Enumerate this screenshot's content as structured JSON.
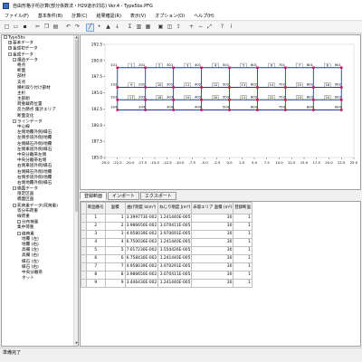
{
  "window": {
    "title": "自由形格子桁計算(部分係数法・H29道示対応) Ver.4 - Type5bs.PFG"
  },
  "menu": [
    "ファイル(F)",
    "基本条件(B)",
    "計算(C)",
    "結果確認(R)",
    "表示(V)",
    "オプション(O)",
    "ヘルプ(H)"
  ],
  "toolbar_icons": [
    "new-file-icon",
    "open-icon",
    "save-icon",
    "sep",
    "cut-icon",
    "copy-icon",
    "paste-icon",
    "sep",
    "undo-icon",
    "redo-icon",
    "sep",
    "member-icon",
    "node-icon",
    "support-icon",
    "load-icon",
    "sep",
    "calc-icon",
    "result-icon",
    "graph-icon",
    "sep",
    "print-icon",
    "preview-icon",
    "export-icon",
    "sep",
    "zoom-in-icon",
    "zoom-out-icon",
    "fit-icon",
    "sep",
    "help-icon",
    "info-icon"
  ],
  "tree": [
    {
      "indent": 0,
      "tog": "-",
      "label": "Type5bs"
    },
    {
      "indent": 1,
      "tog": "+",
      "label": "基本データ"
    },
    {
      "indent": 1,
      "tog": "+",
      "label": "金成初データ"
    },
    {
      "indent": 1,
      "tog": "-",
      "label": "金成データ"
    },
    {
      "indent": 2,
      "tog": "-",
      "label": "構造データ"
    },
    {
      "indent": 3,
      "tog": "",
      "label": "格点"
    },
    {
      "indent": 3,
      "tog": "",
      "label": "断面"
    },
    {
      "indent": 3,
      "tog": "",
      "label": "部材"
    },
    {
      "indent": 3,
      "tog": "",
      "label": "支点"
    },
    {
      "indent": 3,
      "tog": "",
      "label": "横桁取り付け部材"
    },
    {
      "indent": 3,
      "tog": "",
      "label": "主桁"
    },
    {
      "indent": 3,
      "tog": "",
      "label": "主部組"
    },
    {
      "indent": 3,
      "tog": "",
      "label": "荷重載荷位置"
    },
    {
      "indent": 3,
      "tog": "",
      "label": "反力節点 集計エリア"
    },
    {
      "indent": 3,
      "tog": "",
      "label": "断面変化"
    },
    {
      "indent": 2,
      "tog": "-",
      "label": "ラインデータ"
    },
    {
      "indent": 3,
      "tog": "",
      "label": "中心線"
    },
    {
      "indent": 3,
      "tog": "",
      "label": "左側地覆外側/縁石"
    },
    {
      "indent": 3,
      "tog": "",
      "label": "左側歩道外側/地覆"
    },
    {
      "indent": 3,
      "tog": "",
      "label": "左側縁石外側/地覆"
    },
    {
      "indent": 3,
      "tog": "",
      "label": "左側車道外側/縁石"
    },
    {
      "indent": 3,
      "tog": "",
      "label": "中央分離帯左側"
    },
    {
      "indent": 3,
      "tog": "",
      "label": "中央分離帯右側"
    },
    {
      "indent": 3,
      "tog": "",
      "label": "右側車道外側/縁石"
    },
    {
      "indent": 3,
      "tog": "",
      "label": "右側縁石外側/地覆"
    },
    {
      "indent": 3,
      "tog": "",
      "label": "右側歩道外側/地覆"
    },
    {
      "indent": 3,
      "tog": "",
      "label": "右側地覆外側/縁石"
    },
    {
      "indent": 2,
      "tog": "-",
      "label": "橋面データ"
    },
    {
      "indent": 3,
      "tog": "",
      "label": "限定区画"
    },
    {
      "indent": 3,
      "tog": "",
      "label": "橋面区画"
    },
    {
      "indent": 2,
      "tog": "-",
      "label": "死荷重データ(死荷重)"
    },
    {
      "indent": 3,
      "tog": "",
      "label": "等分布荷重"
    },
    {
      "indent": 3,
      "tog": "",
      "label": "線荷重"
    },
    {
      "indent": 3,
      "tog": "-",
      "label": "分布荷重"
    },
    {
      "indent": 3,
      "tog": "",
      "label": "集中荷重"
    },
    {
      "indent": 3,
      "tog": "-",
      "label": "線荷重"
    },
    {
      "indent": 4,
      "tog": "",
      "label": "地覆 (左)"
    },
    {
      "indent": 4,
      "tog": "",
      "label": "地覆 (右)"
    },
    {
      "indent": 4,
      "tog": "",
      "label": "高欄 (左)"
    },
    {
      "indent": 4,
      "tog": "",
      "label": "高欄 (右)"
    },
    {
      "indent": 4,
      "tog": "",
      "label": "縁石 (左)"
    },
    {
      "indent": 4,
      "tog": "",
      "label": "縁石 (右)"
    },
    {
      "indent": 4,
      "tog": "",
      "label": "中央分離帯"
    },
    {
      "indent": 4,
      "tog": "",
      "label": "ネット"
    }
  ],
  "plot": {
    "y_ticks": [
      "202.5",
      "200.0",
      "197.5",
      "195.0",
      "192.5",
      "190.0",
      "187.5",
      "185.0"
    ],
    "x_ticks": [
      "-25.0",
      "-22.5",
      "-20.0",
      "-17.5",
      "-15.0",
      "-12.5",
      "-10.0",
      "-7.5",
      "-5.0",
      "-2.5",
      "0.0",
      "2.5",
      "5.0",
      "7.5",
      "10.0",
      "12.5",
      "15.0",
      "17.5",
      "20.0",
      "22.5",
      "25.0"
    ],
    "node_labels_top": [
      "101",
      "201",
      "301",
      "401",
      "501",
      "601",
      "701",
      "801",
      "901"
    ],
    "node_labels_mid": [
      "102",
      "202",
      "302",
      "402",
      "502",
      "602",
      "702",
      "802",
      "902"
    ],
    "node_labels_bot": [
      "103",
      "203",
      "303",
      "403",
      "503",
      "603",
      "703",
      "803",
      "903"
    ],
    "node_labels_low": [
      "104",
      "204",
      "304",
      "404",
      "504",
      "604",
      "704",
      "804",
      "904"
    ],
    "member_labels_top": [
      "1",
      "2",
      "3",
      "4",
      "5",
      "6",
      "7",
      "8"
    ],
    "member_labels_mid": [
      "9",
      "10",
      "11",
      "12",
      "13",
      "14",
      "15",
      "16"
    ],
    "member_labels_bot": [
      "17",
      "18",
      "19",
      "20",
      "21",
      "22",
      "23",
      "24"
    ]
  },
  "tabs": [
    "登録断面",
    "インポート",
    "エクスポート"
  ],
  "table": {
    "headers": [
      "断面番号",
      "面積",
      "曲げ剛度 Iz(m⁴)",
      "ねじり剛度 J(m⁴)",
      "床版エリア 面積 (m²)",
      "登録断面"
    ],
    "rows": [
      [
        "1",
        "1",
        "3.399773E-002",
        "1.241440E-005",
        "30",
        "1"
      ],
      [
        "2",
        "2",
        "3.986650E-002",
        "3.070411E-005",
        "30",
        "1"
      ],
      [
        "3",
        "3",
        "4.958039E-002",
        "3.970691E-005",
        "30",
        "1"
      ],
      [
        "4",
        "4",
        "6.750036E-002",
        "1.241440E-005",
        "30",
        "1"
      ],
      [
        "5",
        "5",
        "7.017230E-002",
        "3.550426E-005",
        "30",
        "1"
      ],
      [
        "6",
        "6",
        "6.758430E-002",
        "1.241440E-005",
        "30",
        "1"
      ],
      [
        "7",
        "7",
        "4.958039E-002",
        "3.970291E-005",
        "30",
        "1"
      ],
      [
        "8",
        "8",
        "3.986650E-002",
        "3.070411E-005",
        "30",
        "1"
      ],
      [
        "9",
        "9",
        "3.446430E-002",
        "1.241440E-005",
        "30",
        "1"
      ]
    ]
  },
  "status": "準備完了",
  "colors": {
    "member": "#1a3fa0",
    "node": "#d4145a",
    "frame": "#a0a0a0"
  }
}
